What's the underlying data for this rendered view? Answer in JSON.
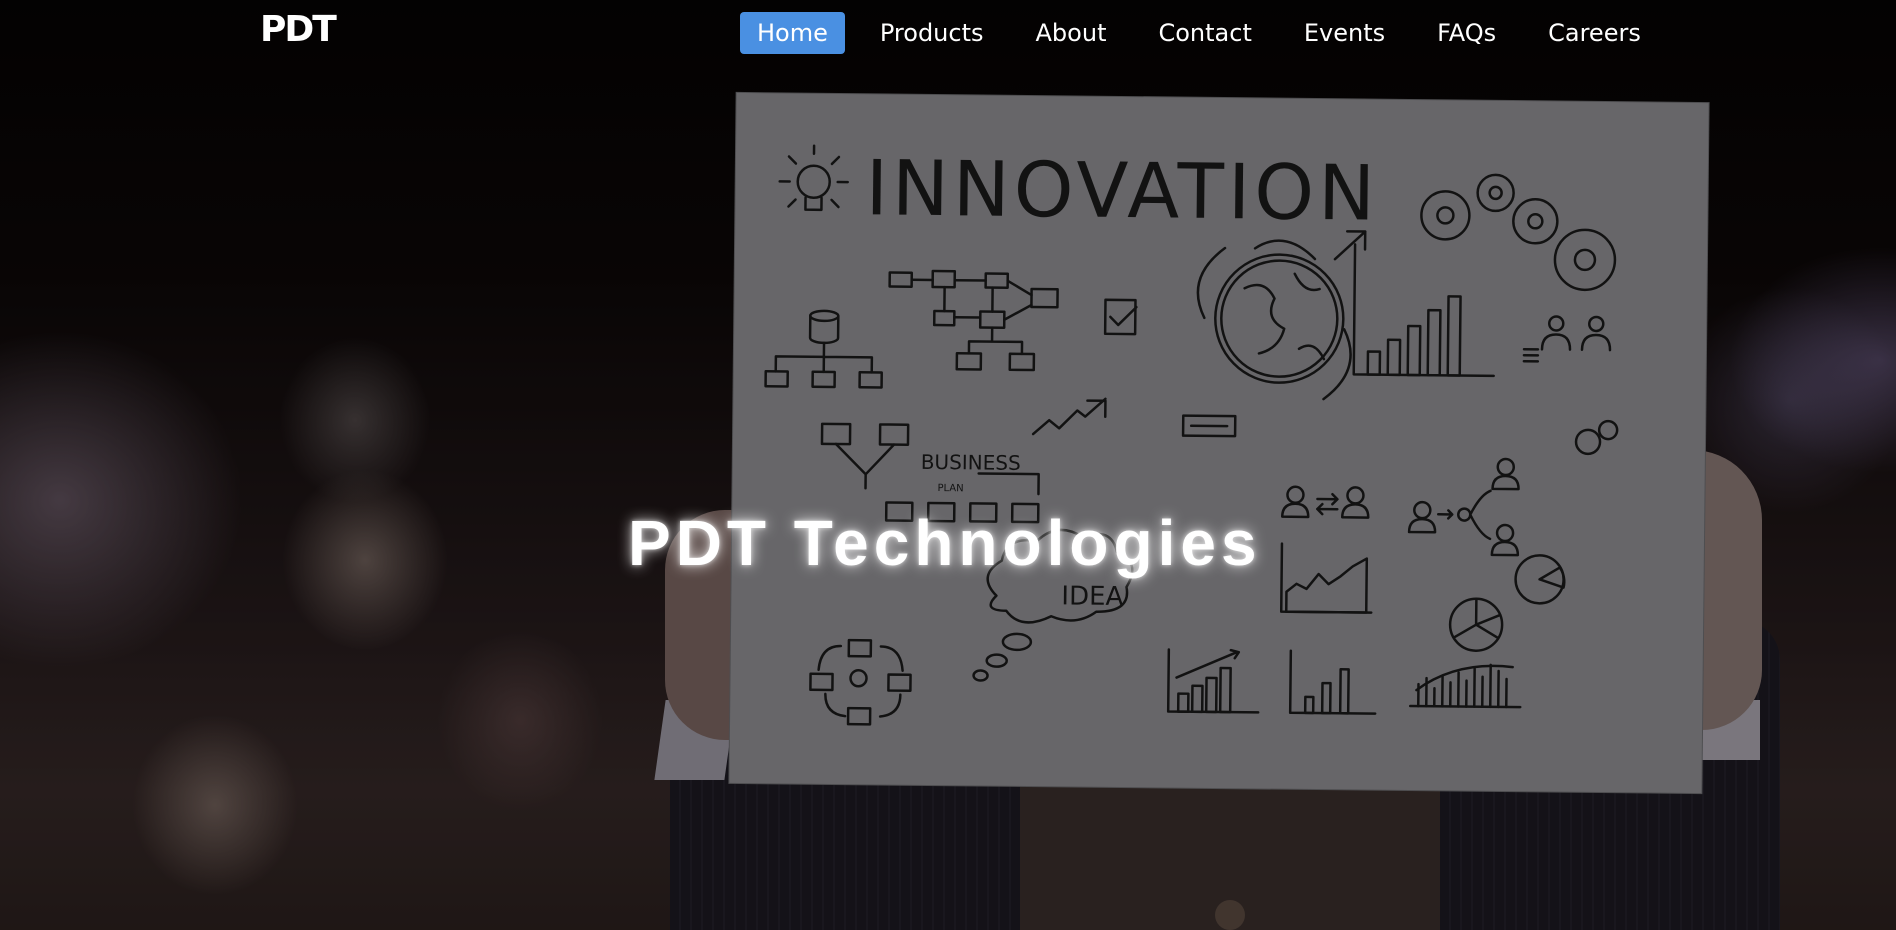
{
  "brand": {
    "logo_text": "PDT"
  },
  "nav": {
    "items": [
      {
        "label": "Home",
        "active": true
      },
      {
        "label": "Products",
        "active": false
      },
      {
        "label": "About",
        "active": false
      },
      {
        "label": "Contact",
        "active": false
      },
      {
        "label": "Events",
        "active": false
      },
      {
        "label": "FAQs",
        "active": false
      },
      {
        "label": "Careers",
        "active": false
      }
    ],
    "active_color": "#4a90e2"
  },
  "hero": {
    "title": "PDT Technologies",
    "board_words": {
      "innovation": "INNOVATION",
      "business": "BUSINESS",
      "plan": "PLAN",
      "idea": "IDEA"
    }
  }
}
